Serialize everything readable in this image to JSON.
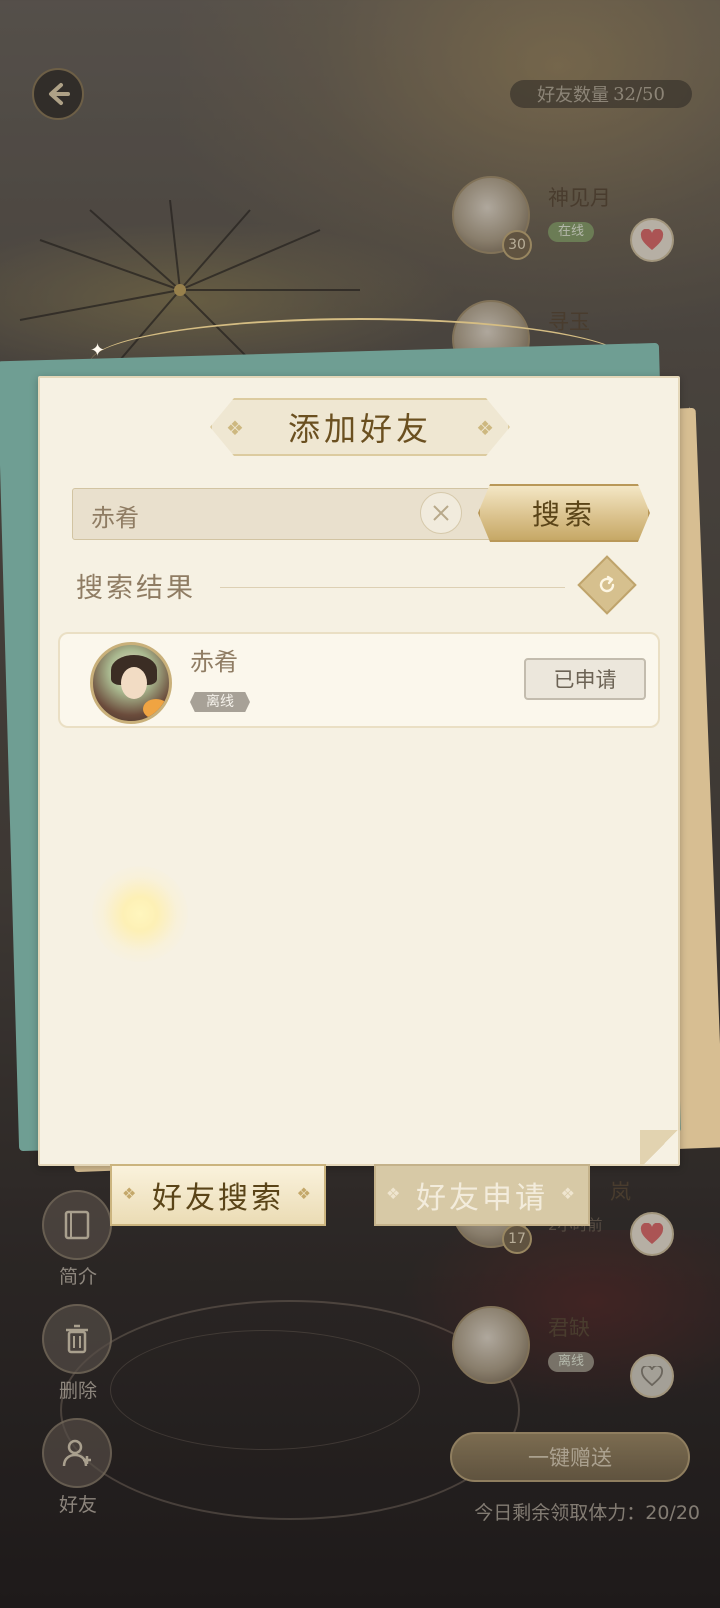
{
  "header": {
    "friend_count_label": "好友数量",
    "friend_count_value": "32/50"
  },
  "friend_list": [
    {
      "name": "神见月",
      "level": "30",
      "status": "在线"
    },
    {
      "name": "寻玉",
      "level": "",
      "status": ""
    },
    {
      "name": "岚",
      "level": "17",
      "sub": "2小时前"
    },
    {
      "name": "君缺",
      "status": "离线"
    }
  ],
  "side_buttons": {
    "profile": "简介",
    "delete": "删除",
    "friend": "好友"
  },
  "bottom_bar": {
    "gift_all": "一键赠送",
    "stamina": "今日剩余领取体力：20/20"
  },
  "modal": {
    "title": "添加好友",
    "search": {
      "value": "赤肴",
      "button": "搜索"
    },
    "results_label": "搜索结果",
    "result": {
      "name": "赤肴",
      "status": "离线",
      "action": "已申请"
    },
    "tabs": [
      {
        "label": "好友搜索",
        "active": true
      },
      {
        "label": "好友申请",
        "active": false
      }
    ]
  },
  "colors": {
    "accent_gold": "#d9c08a",
    "paper": "#f6f1e3",
    "paper_green": "#6f9e93",
    "online_green": "#8aa36d",
    "offline_gray": "#a7a197"
  }
}
